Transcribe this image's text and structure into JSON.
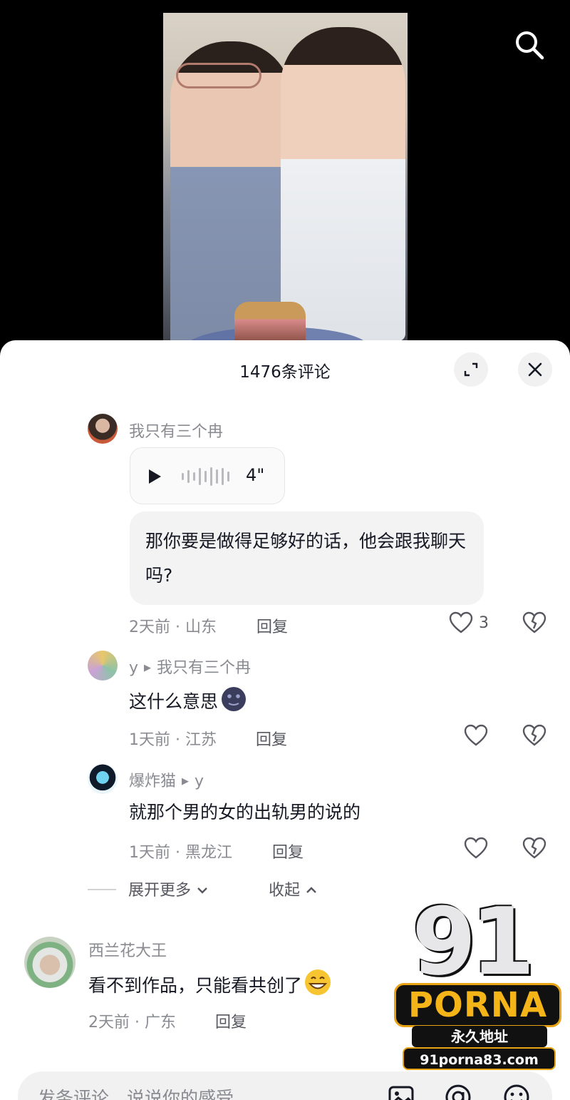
{
  "sheet": {
    "title": "1476条评论"
  },
  "comments": [
    {
      "username": "我只有三个冉",
      "voice_duration": "4\"",
      "transcript": "那你要是做得足够好的话，他会跟我聊天吗?",
      "time": "2天前",
      "location": "山东",
      "reply_label": "回复",
      "likes": "3"
    },
    {
      "username": "y",
      "reply_to": "我只有三个冉",
      "text": "这什么意思",
      "time": "1天前",
      "location": "江苏",
      "reply_label": "回复",
      "likes": ""
    },
    {
      "username": "爆炸猫",
      "reply_to": "y",
      "text": "就那个男的女的出轨男的说的",
      "time": "1天前",
      "location": "黑龙江",
      "reply_label": "回复",
      "likes": ""
    },
    {
      "username": "西兰花大王",
      "text": "看不到作品，只能看共创了",
      "time": "2天前",
      "location": "广东",
      "reply_label": "回复"
    }
  ],
  "thread_controls": {
    "expand_more": "展开更多",
    "collapse": "收起"
  },
  "input": {
    "placeholder": "发条评论，说说你的感受"
  },
  "watermark": {
    "number": "91",
    "brand": "PORNA",
    "subtitle": "永久地址",
    "url": "91porna83.com"
  },
  "colors": {
    "text_primary": "#161823",
    "text_secondary": "#8a8b91",
    "sheet_bg": "#ffffff",
    "chip_bg": "#f1f1f2",
    "watermark_gold": "#f5b417"
  }
}
